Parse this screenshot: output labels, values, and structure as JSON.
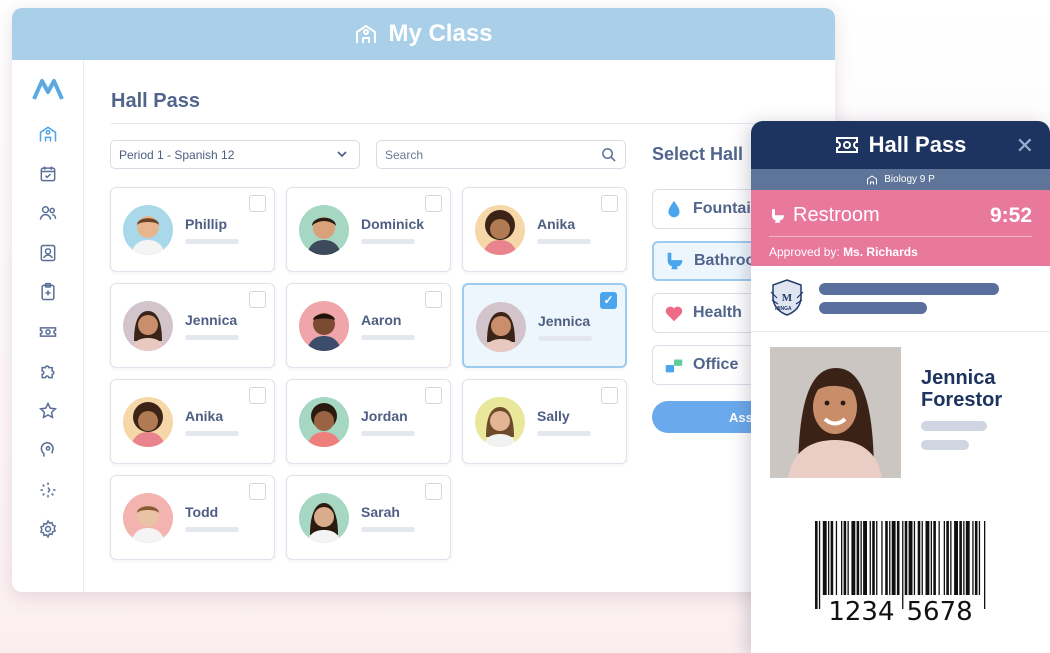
{
  "window": {
    "title": "My Class",
    "title_icon": "school-icon"
  },
  "sidebar": {
    "logo": "minga-logo",
    "items": [
      {
        "icon": "school-icon"
      },
      {
        "icon": "calendar-check-icon"
      },
      {
        "icon": "users-icon"
      },
      {
        "icon": "id-card-icon"
      },
      {
        "icon": "clipboard-icon"
      },
      {
        "icon": "ticket-icon"
      },
      {
        "icon": "puzzle-icon"
      },
      {
        "icon": "star-icon"
      },
      {
        "icon": "head-icon"
      },
      {
        "icon": "loader-icon"
      },
      {
        "icon": "gear-icon"
      }
    ]
  },
  "main": {
    "title": "Hall Pass",
    "period_select": {
      "value": "Period 1 - Spanish 12"
    },
    "search": {
      "placeholder": "Search"
    },
    "students": [
      {
        "name": "Phillip",
        "checked": false
      },
      {
        "name": "Dominick",
        "checked": false
      },
      {
        "name": "Anika",
        "checked": false
      },
      {
        "name": "Jennica",
        "checked": false
      },
      {
        "name": "Aaron",
        "checked": false
      },
      {
        "name": "Jennica",
        "checked": true
      },
      {
        "name": "Anika",
        "checked": false
      },
      {
        "name": "Jordan",
        "checked": false
      },
      {
        "name": "Sally",
        "checked": false
      },
      {
        "name": "Todd",
        "checked": false
      },
      {
        "name": "Sarah",
        "checked": false
      }
    ],
    "select_hall": {
      "title": "Select Hall",
      "options": [
        {
          "label": "Fountain",
          "icon": "water-drop-icon"
        },
        {
          "label": "Bathroom",
          "icon": "toilet-icon",
          "active": true
        },
        {
          "label": "Health",
          "icon": "heart-icon"
        },
        {
          "label": "Office",
          "icon": "office-icon"
        }
      ],
      "assign_label": "Assign"
    }
  },
  "pass": {
    "title": "Hall Pass",
    "close": "✕",
    "class_label": "Biology 9 P",
    "destination": "Restroom",
    "timer": "9:52",
    "approved_prefix": "Approved by:",
    "approved_by": "Ms. Richards",
    "school_crest_text": "MINGA",
    "student_first": "Jennica",
    "student_last": "Forestor",
    "barcode_left": "1234",
    "barcode_right": "5678"
  },
  "colors": {
    "titlebar": "#a9cfe9",
    "pass_header": "#1d3461",
    "pass_status": "#e8789c",
    "accent": "#4aa5ec"
  }
}
